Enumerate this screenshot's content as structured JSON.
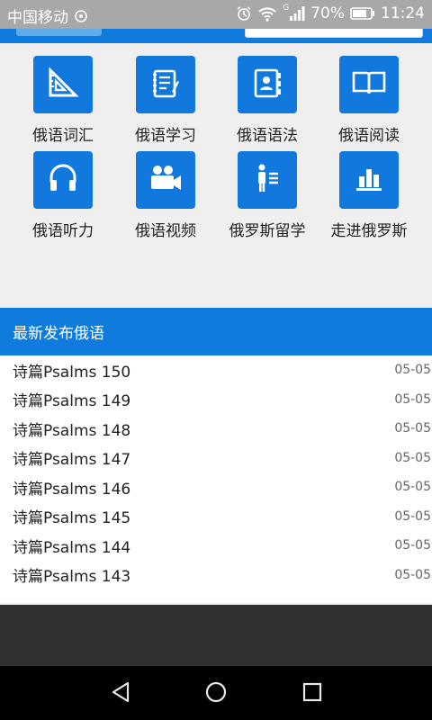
{
  "status_bar": {
    "carrier": "中国移动",
    "battery": "70%",
    "time": "11:24",
    "network": "G",
    "icons": [
      "carrier-signal-icon",
      "alarm-icon",
      "wifi-icon",
      "cell-signal-icon",
      "battery-icon"
    ]
  },
  "categories": [
    {
      "label": "俄语词汇",
      "icon": "ruler-triangle-icon"
    },
    {
      "label": "俄语学习",
      "icon": "notepad-icon"
    },
    {
      "label": "俄语语法",
      "icon": "contact-book-icon"
    },
    {
      "label": "俄语阅读",
      "icon": "open-book-icon"
    },
    {
      "label": "俄语听力",
      "icon": "headphones-icon"
    },
    {
      "label": "俄语视频",
      "icon": "video-camera-icon"
    },
    {
      "label": "俄罗斯留学",
      "icon": "person-list-icon"
    },
    {
      "label": "走进俄罗斯",
      "icon": "bar-chart-icon"
    }
  ],
  "latest": {
    "title": "最新发布俄语",
    "items": [
      {
        "title": "诗篇Psalms 150",
        "date": "05-05"
      },
      {
        "title": "诗篇Psalms 149",
        "date": "05-05"
      },
      {
        "title": "诗篇Psalms 148",
        "date": "05-05"
      },
      {
        "title": "诗篇Psalms 147",
        "date": "05-05"
      },
      {
        "title": "诗篇Psalms 146",
        "date": "05-05"
      },
      {
        "title": "诗篇Psalms 145",
        "date": "05-05"
      },
      {
        "title": "诗篇Psalms 144",
        "date": "05-05"
      },
      {
        "title": "诗篇Psalms 143",
        "date": "05-05"
      }
    ]
  },
  "colors": {
    "accent": "#0f7bdc",
    "icon_bg": "#1179dd",
    "nav_bg": "#000000",
    "dark_band": "#303030"
  }
}
